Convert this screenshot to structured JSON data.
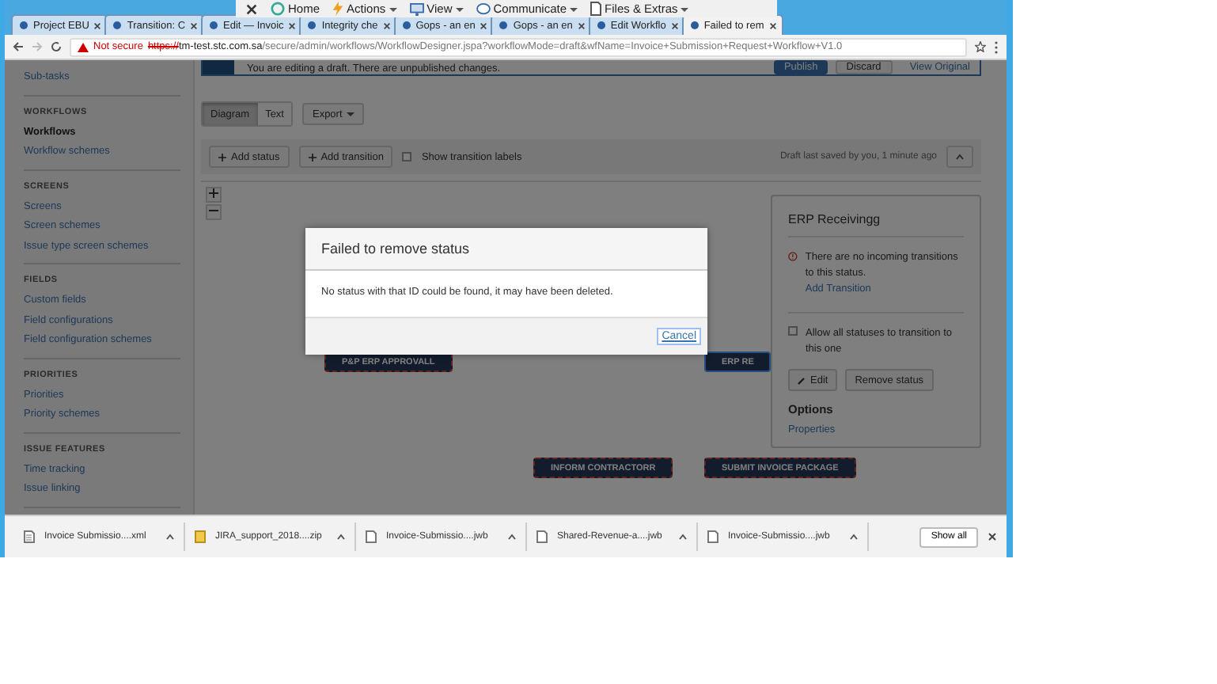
{
  "browser": {
    "tabs": [
      {
        "title": "Project EBU",
        "selected": false
      },
      {
        "title": "Transition: C",
        "selected": false
      },
      {
        "title": "Edit — Invoic",
        "selected": false
      },
      {
        "title": "Integrity che",
        "selected": false
      },
      {
        "title": "Gops - an en",
        "selected": false
      },
      {
        "title": "Gops - an en",
        "selected": false
      },
      {
        "title": "Edit Workflo",
        "selected": false
      },
      {
        "title": "Failed to rem",
        "selected": true
      }
    ],
    "remote_toolbar": [
      {
        "label": "Home",
        "menu": false
      },
      {
        "label": "Actions",
        "menu": true
      },
      {
        "label": "View",
        "menu": true
      },
      {
        "label": "Communicate",
        "menu": true
      },
      {
        "label": "Files & Extras",
        "menu": true
      }
    ],
    "address": {
      "security": "Not secure",
      "scheme": "https://",
      "host": "tm-test.stc.com.sa",
      "path": "/secure/admin/workflows/WorkflowDesigner.jspa?workflowMode=draft&wfName=Invoice+Submission+Request+Workflow+V1.0"
    }
  },
  "sidebar": {
    "sections": [
      {
        "items": [
          {
            "label": "Sub-tasks",
            "selected": false
          }
        ]
      },
      {
        "heading": "WORKFLOWS",
        "items": [
          {
            "label": "Workflows",
            "selected": true
          },
          {
            "label": "Workflow schemes",
            "selected": false
          }
        ]
      },
      {
        "heading": "SCREENS",
        "items": [
          {
            "label": "Screens",
            "selected": false
          },
          {
            "label": "Screen schemes",
            "selected": false
          },
          {
            "label": "Issue type screen schemes",
            "selected": false
          }
        ]
      },
      {
        "heading": "FIELDS",
        "items": [
          {
            "label": "Custom fields",
            "selected": false
          },
          {
            "label": "Field configurations",
            "selected": false
          },
          {
            "label": "Field configuration schemes",
            "selected": false
          }
        ]
      },
      {
        "heading": "PRIORITIES",
        "items": [
          {
            "label": "Priorities",
            "selected": false
          },
          {
            "label": "Priority schemes",
            "selected": false
          }
        ]
      },
      {
        "heading": "ISSUE FEATURES",
        "items": [
          {
            "label": "Time tracking",
            "selected": false
          },
          {
            "label": "Issue linking",
            "selected": false
          }
        ]
      }
    ]
  },
  "draft_banner": {
    "message": "You are editing a draft. There are unpublished changes.",
    "buttons": [
      {
        "label": "Publish",
        "kind": "primary"
      },
      {
        "label": "Discard",
        "kind": "default"
      },
      {
        "label": "View Original",
        "kind": "link"
      }
    ]
  },
  "view_tabs": [
    {
      "label": "Diagram",
      "selected": true
    },
    {
      "label": "Text",
      "selected": false
    }
  ],
  "export": "Export",
  "toolbar": {
    "add_status": "Add status",
    "add_transition": "Add transition",
    "show_labels": {
      "label": "Show transition labels",
      "checked": false
    },
    "saved": "Draft last saved by you, 1 minute ago"
  },
  "nodes": [
    {
      "label": "P&P ERP APPROVALL",
      "selected": false
    },
    {
      "label": "ERP RE",
      "selected": true
    },
    {
      "label": "INFORM CONTRACTORR",
      "selected": false
    },
    {
      "label": "SUBMIT INVOICE PACKAGE",
      "selected": false
    }
  ],
  "panel": {
    "title": "ERP Receivingg",
    "warning": "There are no incoming transitions to this status.",
    "add_transition": "Add Transition",
    "allow_all": {
      "label": "Allow all statuses to transition to this one",
      "checked": false
    },
    "edit": "Edit",
    "remove": "Remove status",
    "options": "Options",
    "properties": "Properties"
  },
  "dialog": {
    "title": "Failed to remove status",
    "message": "No status with that ID could be found, it may have been deleted.",
    "cancel": "Cancel"
  },
  "downloads": {
    "items": [
      {
        "name": "Invoice Submissio....xml",
        "kind": "text"
      },
      {
        "name": "JIRA_support_2018....zip",
        "kind": "zip"
      },
      {
        "name": "Invoice-Submissio....jwb",
        "kind": "file"
      },
      {
        "name": "Shared-Revenue-a....jwb",
        "kind": "file"
      },
      {
        "name": "Invoice-Submissio....jwb",
        "kind": "file"
      }
    ],
    "show_all": "Show all"
  }
}
